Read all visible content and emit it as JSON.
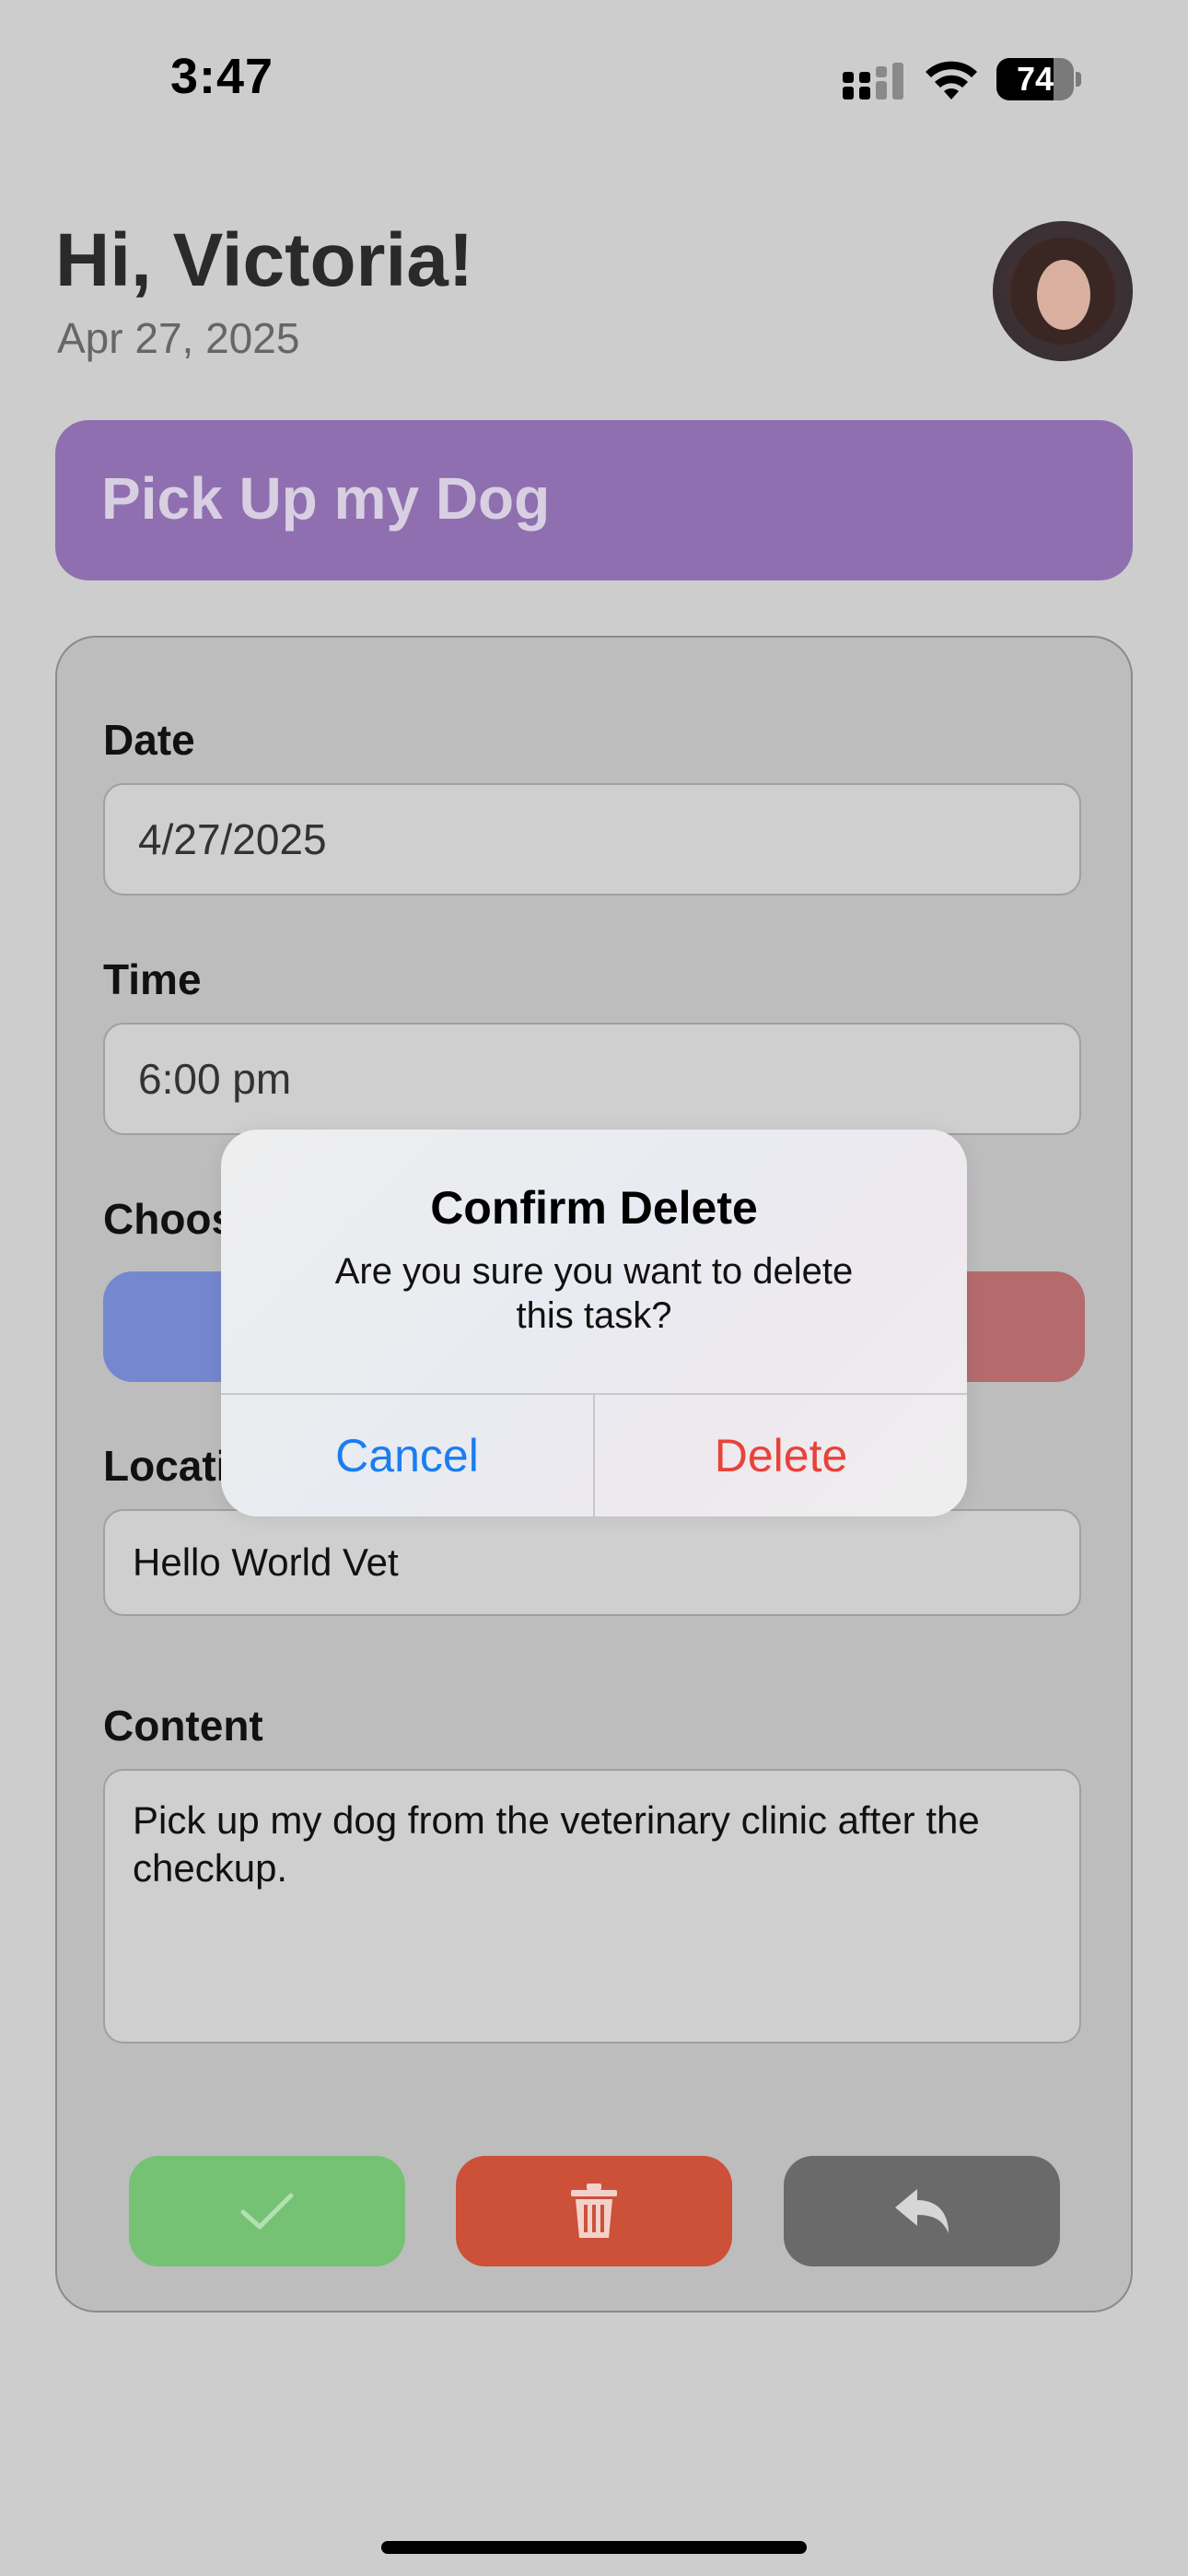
{
  "status_bar": {
    "time": "3:47",
    "battery": "74",
    "battery_level": 0.74,
    "icons": [
      "signal-icon",
      "wifi-icon",
      "battery-icon"
    ]
  },
  "header": {
    "greeting": "Hi, Victoria!",
    "date": "Apr 27, 2025"
  },
  "task": {
    "title": "Pick Up my Dog"
  },
  "form": {
    "date_label": "Date",
    "date_value": "4/27/2025",
    "time_label": "Time",
    "time_value": "6:00 pm",
    "color_label": "Choos",
    "color_options": [
      "#7587cf",
      "#b56b6c"
    ],
    "location_label": "Locati",
    "location_value": "Hello World Vet",
    "content_label": "Content",
    "content_value": "Pick up my dog from the veterinary clinic after the checkup."
  },
  "actions": {
    "save_color": "#76c275",
    "delete_color": "#cd5039",
    "back_color": "#6a6a6a",
    "icons": [
      "checkmark-icon",
      "trash-icon",
      "reply-icon"
    ]
  },
  "dialog": {
    "title": "Confirm Delete",
    "message": "Are you sure you want to delete this task?",
    "cancel_label": "Cancel",
    "delete_label": "Delete",
    "cancel_color": "#1a7df2",
    "delete_color": "#e8423a"
  },
  "colors": {
    "background": "#cdcdcd",
    "banner": "#8f6faf"
  }
}
